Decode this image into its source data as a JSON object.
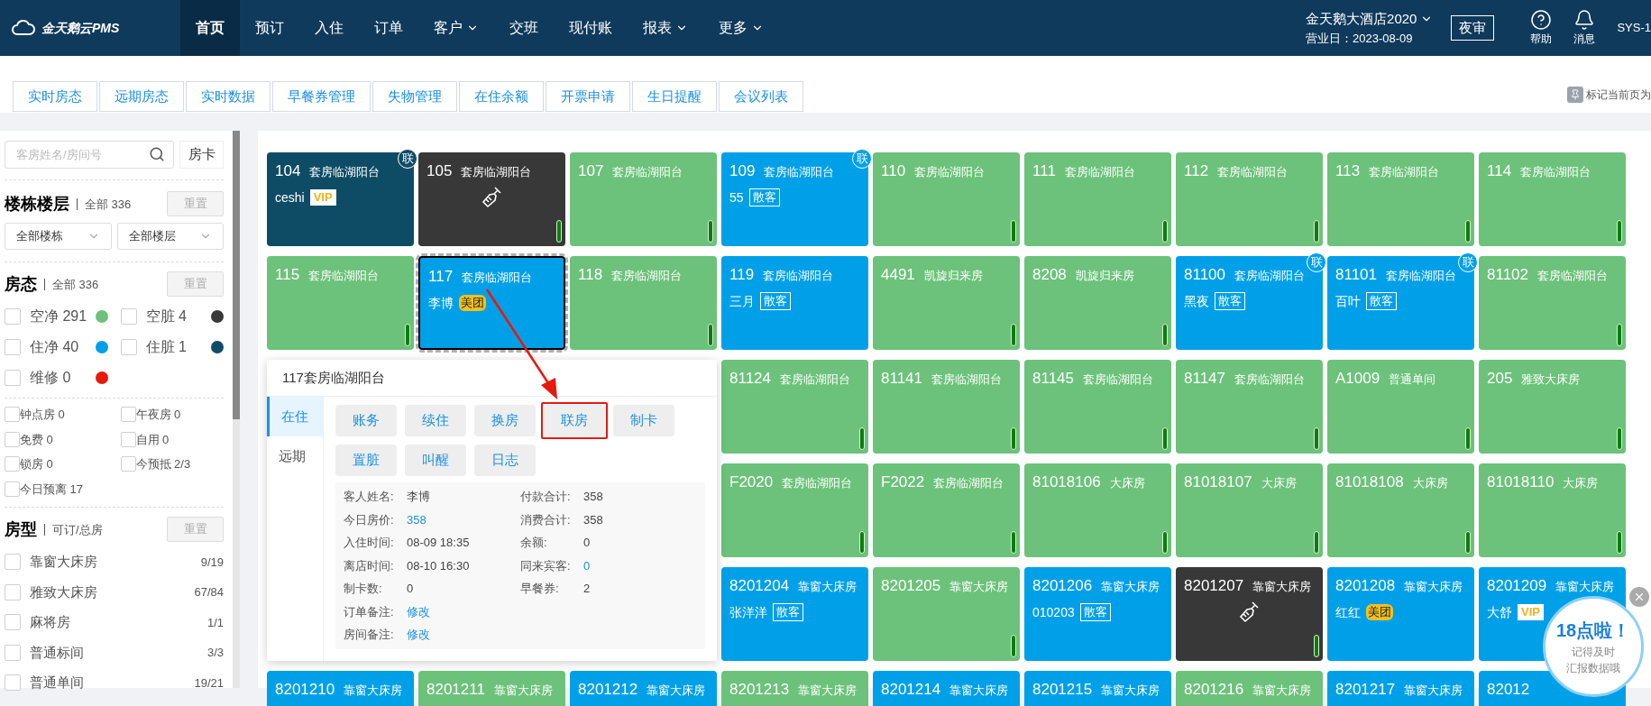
{
  "header": {
    "logo": "金天鹅云PMS",
    "nav": [
      {
        "label": "首页",
        "selected": true,
        "dropdown": false
      },
      {
        "label": "预订",
        "selected": false,
        "dropdown": false
      },
      {
        "label": "入住",
        "selected": false,
        "dropdown": false
      },
      {
        "label": "订单",
        "selected": false,
        "dropdown": false
      },
      {
        "label": "客户",
        "selected": false,
        "dropdown": true
      },
      {
        "label": "交班",
        "selected": false,
        "dropdown": false
      },
      {
        "label": "现付账",
        "selected": false,
        "dropdown": false
      },
      {
        "label": "报表",
        "selected": false,
        "dropdown": true
      },
      {
        "label": "更多",
        "selected": false,
        "dropdown": true
      }
    ],
    "hotel": "金天鹅大酒店2020",
    "business_day": "营业日：2023-08-09",
    "night_audit": "夜审",
    "actions": [
      {
        "kind": "help",
        "label": "帮助"
      },
      {
        "kind": "bell",
        "label": "消息"
      }
    ],
    "user": "SYS-1"
  },
  "page_tabs": [
    "实时房态",
    "远期房态",
    "实时数据",
    "早餐券管理",
    "失物管理",
    "在住余额",
    "开票申请",
    "生日提醒",
    "会议列表"
  ],
  "bookmark": "标记当前页为",
  "sidebar": {
    "search": {
      "placeholder": "客房姓名/房间号"
    },
    "card_button": "房卡",
    "floor": {
      "title": "楼栋楼层",
      "summary": "全部 336",
      "reset": "重置",
      "selects": [
        "全部楼栋",
        "全部楼层"
      ]
    },
    "status": {
      "title": "房态",
      "summary": "全部 336",
      "reset": "重置",
      "items": [
        {
          "label": "空净 291",
          "checked": false,
          "color": "#6cc27a"
        },
        {
          "label": "空脏 4",
          "checked": false,
          "color": "#383838"
        },
        {
          "label": "住净 40",
          "checked": false,
          "color": "#00a0e9"
        },
        {
          "label": "住脏 1",
          "checked": false,
          "color": "#0e4c66"
        },
        {
          "label": "维修 0",
          "checked": false,
          "color": "#e8180c"
        }
      ]
    },
    "flags": [
      {
        "label": "钟点房 0",
        "checked": false
      },
      {
        "label": "午夜房 0",
        "checked": false
      },
      {
        "label": "免费 0",
        "checked": false
      },
      {
        "label": "自用 0",
        "checked": false
      },
      {
        "label": "锁房 0",
        "checked": false
      },
      {
        "label": "今预抵 2/3",
        "checked": false
      },
      {
        "label": "今日预离 17",
        "checked": false
      }
    ],
    "room_types": {
      "title": "房型",
      "summary": "可订/总房",
      "reset": "重置",
      "items": [
        {
          "label": "靠窗大床房",
          "count": "9/19",
          "checked": false
        },
        {
          "label": "雅致大床房",
          "count": "67/84",
          "checked": false
        },
        {
          "label": "麻将房",
          "count": "1/1",
          "checked": false
        },
        {
          "label": "普通标间",
          "count": "3/3",
          "checked": false
        },
        {
          "label": "普通单间",
          "count": "19/21",
          "checked": false
        }
      ]
    }
  },
  "rooms": [
    {
      "number": "104",
      "type": "套房临湖阳台",
      "kind": "occupied_dirty",
      "guest": "ceshi",
      "tag": {
        "kind": "vip",
        "label": "VIP"
      },
      "badge": "联",
      "selected": false
    },
    {
      "number": "105",
      "type": "套房临湖阳台",
      "kind": "vacant_dirty",
      "selected": false
    },
    {
      "number": "107",
      "type": "套房临湖阳台",
      "kind": "vacant_clean",
      "selected": false
    },
    {
      "number": "109",
      "type": "套房临湖阳台",
      "kind": "occupied_clean",
      "guest": "55",
      "tag": {
        "kind": "walkin",
        "label": "散客"
      },
      "badge": "联",
      "selected": false
    },
    {
      "number": "110",
      "type": "套房临湖阳台",
      "kind": "vacant_clean",
      "selected": false
    },
    {
      "number": "111",
      "type": "套房临湖阳台",
      "kind": "vacant_clean",
      "selected": false
    },
    {
      "number": "112",
      "type": "套房临湖阳台",
      "kind": "vacant_clean",
      "selected": false
    },
    {
      "number": "113",
      "type": "套房临湖阳台",
      "kind": "vacant_clean",
      "selected": false
    },
    {
      "number": "114",
      "type": "套房临湖阳台",
      "kind": "vacant_clean",
      "selected": false
    },
    {
      "number": "115",
      "type": "套房临湖阳台",
      "kind": "vacant_clean",
      "selected": false
    },
    {
      "number": "117",
      "type": "套房临湖阳台",
      "kind": "occupied_clean",
      "guest": "李博",
      "tag": {
        "kind": "meituan",
        "label": "美团"
      },
      "selected": true
    },
    {
      "number": "118",
      "type": "套房临湖阳台",
      "kind": "vacant_clean",
      "selected": false
    },
    {
      "number": "119",
      "type": "套房临湖阳台",
      "kind": "occupied_clean",
      "guest": "三月",
      "tag": {
        "kind": "walkin",
        "label": "散客"
      },
      "selected": false
    },
    {
      "number": "4491",
      "type": "凯旋归来房",
      "kind": "vacant_clean",
      "selected": false
    },
    {
      "number": "8208",
      "type": "凯旋归来房",
      "kind": "vacant_clean",
      "selected": false
    },
    {
      "number": "81100",
      "type": "套房临湖阳台",
      "kind": "occupied_clean",
      "guest": "黑夜",
      "tag": {
        "kind": "walkin",
        "label": "散客"
      },
      "badge": "联",
      "selected": false
    },
    {
      "number": "81101",
      "type": "套房临湖阳台",
      "kind": "occupied_clean",
      "guest": "百叶",
      "tag": {
        "kind": "walkin",
        "label": "散客"
      },
      "badge": "联",
      "selected": false
    },
    {
      "number": "81102",
      "type": "套房临湖阳台",
      "kind": "vacant_clean",
      "selected": false
    },
    {
      "number": "81124",
      "type": "套房临湖阳台",
      "kind": "vacant_clean",
      "selected": false
    },
    {
      "number": "81141",
      "type": "套房临湖阳台",
      "kind": "vacant_clean",
      "selected": false
    },
    {
      "number": "81145",
      "type": "套房临湖阳台",
      "kind": "vacant_clean",
      "selected": false
    },
    {
      "number": "81147",
      "type": "套房临湖阳台",
      "kind": "vacant_clean",
      "selected": false
    },
    {
      "number": "A1009",
      "type": "普通单间",
      "kind": "vacant_clean",
      "selected": false
    },
    {
      "number": "205",
      "type": "雅致大床房",
      "kind": "vacant_clean",
      "selected": false
    },
    {
      "number": "F2020",
      "type": "套房临湖阳台",
      "kind": "vacant_clean",
      "selected": false
    },
    {
      "number": "F2022",
      "type": "套房临湖阳台",
      "kind": "vacant_clean",
      "selected": false
    },
    {
      "number": "81018106",
      "type": "大床房",
      "kind": "vacant_clean",
      "selected": false
    },
    {
      "number": "81018107",
      "type": "大床房",
      "kind": "vacant_clean",
      "selected": false
    },
    {
      "number": "81018108",
      "type": "大床房",
      "kind": "vacant_clean",
      "selected": false
    },
    {
      "number": "81018110",
      "type": "大床房",
      "kind": "vacant_clean",
      "selected": false
    },
    {
      "number": "8201204",
      "type": "靠窗大床房",
      "kind": "occupied_clean",
      "guest": "张洋洋",
      "tag": {
        "kind": "walkin",
        "label": "散客"
      },
      "selected": false
    },
    {
      "number": "8201205",
      "type": "靠窗大床房",
      "kind": "vacant_clean",
      "selected": false
    },
    {
      "number": "8201206",
      "type": "靠窗大床房",
      "kind": "occupied_clean",
      "guest": "010203",
      "tag": {
        "kind": "walkin",
        "label": "散客"
      },
      "selected": false
    },
    {
      "number": "8201207",
      "type": "靠窗大床房",
      "kind": "vacant_dirty",
      "selected": false
    },
    {
      "number": "8201208",
      "type": "靠窗大床房",
      "kind": "occupied_clean",
      "guest": "红红",
      "tag": {
        "kind": "meituan",
        "label": "美团"
      },
      "selected": false
    },
    {
      "number": "8201209",
      "type": "靠窗大床房",
      "kind": "occupied_clean",
      "guest": "大舒",
      "tag": {
        "kind": "vip",
        "label": "VIP"
      },
      "selected": false
    },
    {
      "number": "8201210",
      "type": "靠窗大床房",
      "kind": "occupied_clean",
      "selected": false
    },
    {
      "number": "8201211",
      "type": "靠窗大床房",
      "kind": "vacant_clean",
      "selected": false
    },
    {
      "number": "8201212",
      "type": "靠窗大床房",
      "kind": "occupied_clean",
      "selected": false
    },
    {
      "number": "8201213",
      "type": "靠窗大床房",
      "kind": "vacant_clean",
      "selected": false
    },
    {
      "number": "8201214",
      "type": "靠窗大床房",
      "kind": "occupied_clean",
      "selected": false
    },
    {
      "number": "8201215",
      "type": "靠窗大床房",
      "kind": "occupied_clean",
      "selected": false
    },
    {
      "number": "8201216",
      "type": "靠窗大床房",
      "kind": "vacant_clean",
      "selected": false
    },
    {
      "number": "8201217",
      "type": "靠窗大床房",
      "kind": "occupied_clean",
      "selected": false
    },
    {
      "number": "82012",
      "kind": "occupied_clean",
      "selected": false
    }
  ],
  "room_popover": {
    "title": "117套房临湖阳台",
    "tabs": [
      {
        "label": "在住",
        "selected": true
      },
      {
        "label": "远期",
        "selected": false
      }
    ],
    "actions": [
      {
        "label": "账务",
        "highlighted": false
      },
      {
        "label": "续住",
        "highlighted": false
      },
      {
        "label": "换房",
        "highlighted": false
      },
      {
        "label": "联房",
        "highlighted": true
      },
      {
        "label": "制卡",
        "highlighted": false
      },
      {
        "label": "置脏",
        "highlighted": false
      },
      {
        "label": "叫醒",
        "highlighted": false
      },
      {
        "label": "日志",
        "highlighted": false
      }
    ],
    "details": [
      [
        {
          "label": "客人姓名:",
          "value": "李博",
          "kind": "text"
        },
        {
          "label": "付款合计:",
          "value": "358",
          "kind": "text"
        }
      ],
      [
        {
          "label": "今日房价:",
          "value": "358",
          "kind": "link"
        },
        {
          "label": "消费合计:",
          "value": "358",
          "kind": "text"
        }
      ],
      [
        {
          "label": "入住时间:",
          "value": "08-09 18:35",
          "kind": "text"
        },
        {
          "label": "余额:",
          "value": "0",
          "kind": "text"
        }
      ],
      [
        {
          "label": "离店时间:",
          "value": "08-10 16:30",
          "kind": "text"
        },
        {
          "label": "同来宾客:",
          "value": "0",
          "kind": "link"
        }
      ],
      [
        {
          "label": "制卡数:",
          "value": "0",
          "kind": "text"
        },
        {
          "label": "早餐券:",
          "value": "2",
          "kind": "text"
        }
      ],
      [
        {
          "label": "订单备注:",
          "value": "修改",
          "kind": "link"
        }
      ],
      [
        {
          "label": "房间备注:",
          "value": "修改",
          "kind": "link"
        }
      ]
    ]
  },
  "reminder": {
    "title": "18点啦！",
    "lines": [
      "记得及时",
      "汇报数据哦"
    ]
  }
}
